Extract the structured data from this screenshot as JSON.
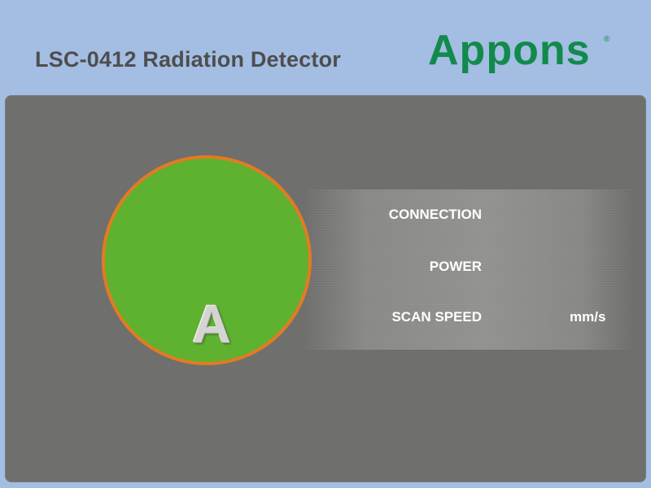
{
  "header": {
    "title": "LSC-0412 Radiation Detector",
    "brand": "Appons",
    "brand_mark": "®",
    "brand_color": "#128a4c"
  },
  "indicator": {
    "letter": "A",
    "fill_color": "#5eb22f",
    "ring_color": "#e37b22"
  },
  "status": {
    "connection_label": "CONNECTION",
    "power_label": "POWER",
    "scan_speed_label": "SCAN SPEED",
    "scan_speed_unit": "mm/s"
  },
  "colors": {
    "background": "#a3bde3",
    "panel": "#6f6f6d",
    "title_text": "#4e4e4e"
  }
}
